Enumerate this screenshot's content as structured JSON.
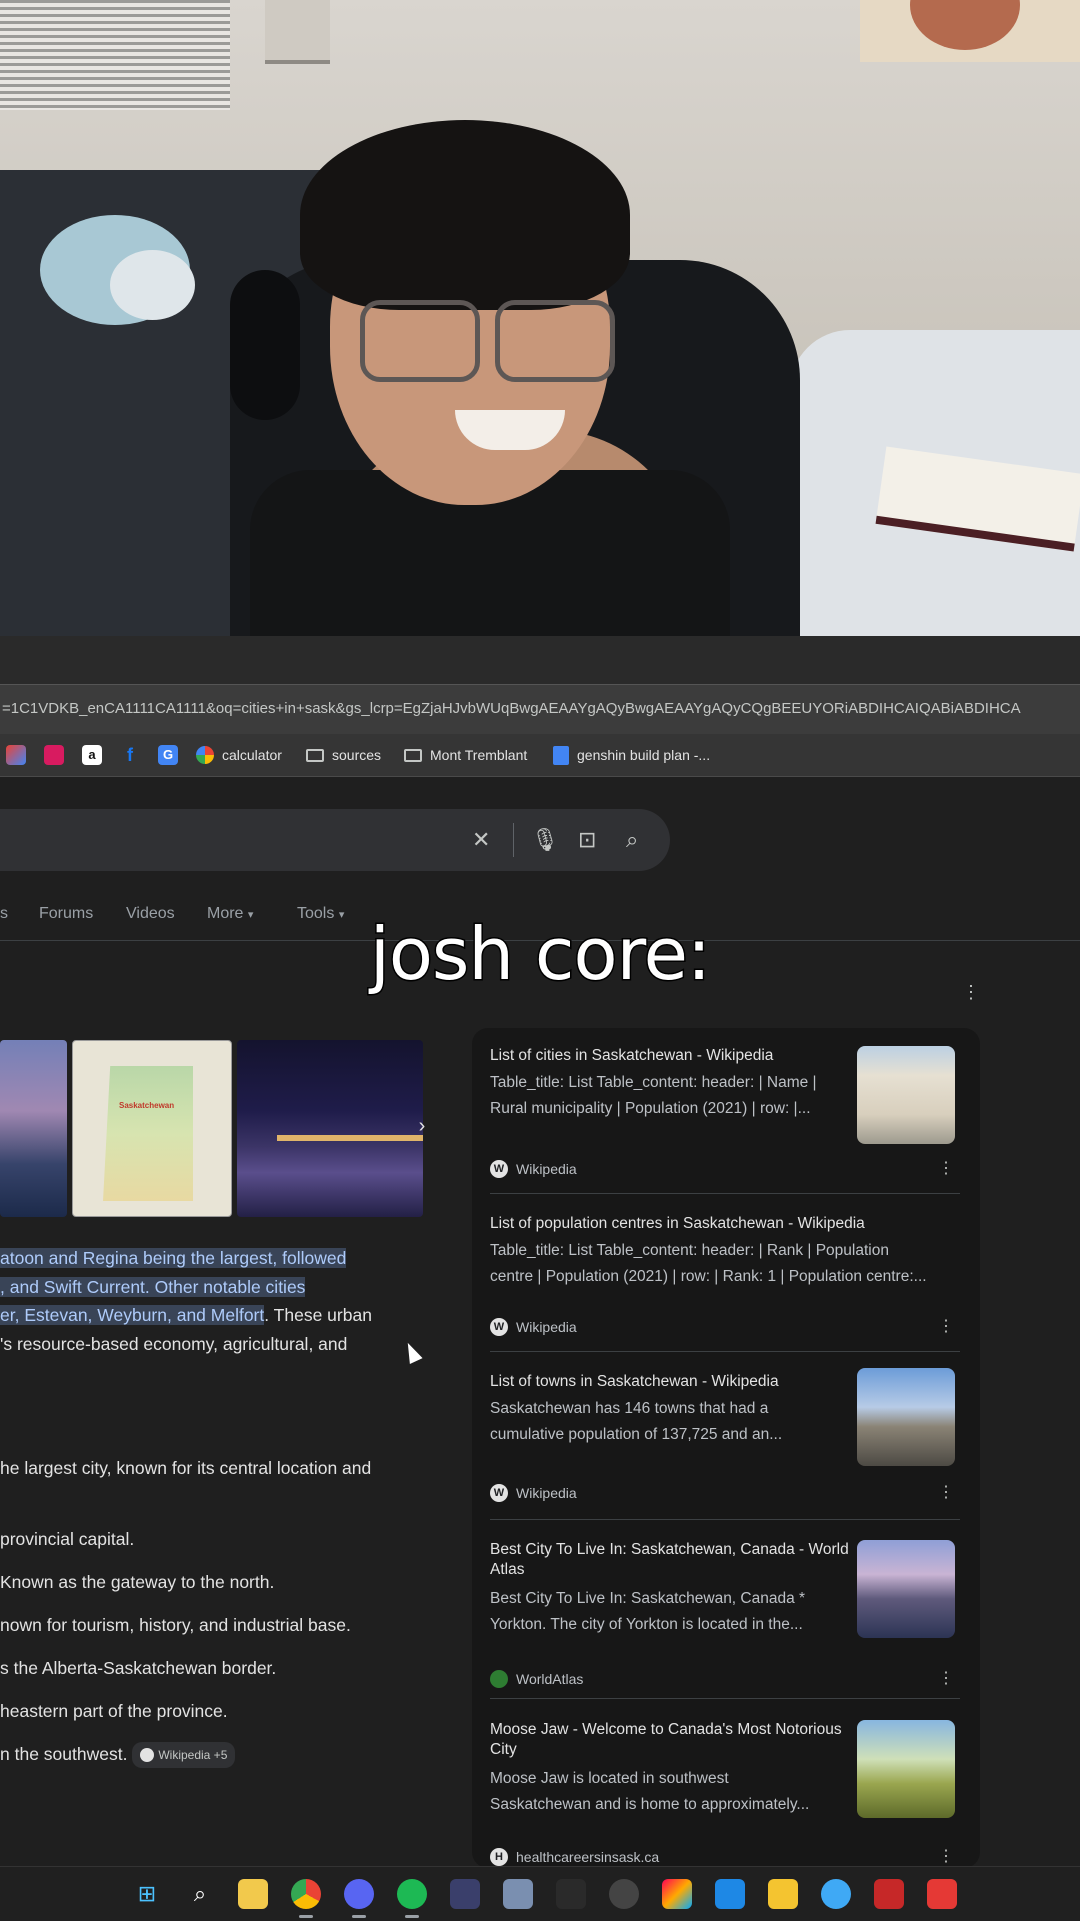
{
  "overlay_caption": "josh core:",
  "browser": {
    "url": "=1C1VDKB_enCA1111CA1111&oq=cities+in+sask&gs_lcrp=EgZjaHJvbWUqBwgAEAAYgAQyBwgAEAAYgAQyCQgBEEUYORiABDIHCAIQABiABDIHCA",
    "bookmarks": [
      {
        "label": "calculator",
        "icon": "google-icon"
      },
      {
        "label": "sources",
        "icon": "folder-icon"
      },
      {
        "label": "Mont Tremblant",
        "icon": "folder-icon"
      },
      {
        "label": "genshin build plan -...",
        "icon": "docs-icon"
      }
    ],
    "bookmark_icons": [
      "extension-icon",
      "app-icon",
      "amazon-icon",
      "facebook-icon",
      "translate-icon"
    ]
  },
  "search": {
    "icons": [
      "clear-icon",
      "mic-icon",
      "lens-icon",
      "search-icon"
    ],
    "tabs": [
      "Forums",
      "Videos",
      "More",
      "Tools"
    ]
  },
  "ai_overview": {
    "lines": [
      {
        "hl": "atoon and Regina being the largest, followed",
        "rest": ""
      },
      {
        "hl": ", and Swift Current. Other notable cities",
        "rest": ""
      },
      {
        "hl": "er, Estevan, Weyburn, and Melfort",
        "rest": ". These urban"
      },
      {
        "hl": "",
        "rest": "'s resource-based economy, agricultural, and"
      }
    ],
    "bullets": [
      "he largest city, known for its central location and",
      "provincial capital.",
      "Known as the gateway to the north.",
      "nown for tourism, history, and industrial base.",
      "s the Alberta-Saskatchewan border.",
      "heastern part of the province.",
      "n the southwest."
    ],
    "chip": "Wikipedia +5",
    "image_labels": {
      "map": "Saskatchewan"
    }
  },
  "results": [
    {
      "title": "List of cities in Saskatchewan - Wikipedia",
      "snippet1": "Table_title: List Table_content: header: | Name |",
      "snippet2": "Rural municipality | Population (2021) | row: |...",
      "source": "Wikipedia",
      "fav": "W",
      "image": "building"
    },
    {
      "title": "List of population centres in Saskatchewan - Wikipedia",
      "snippet1": "Table_title: List Table_content: header: | Rank | Population",
      "snippet2": "centre | Population (2021) | row: | Rank: 1 | Population centre:...",
      "source": "Wikipedia",
      "fav": "W",
      "image": ""
    },
    {
      "title": "List of towns in Saskatchewan - Wikipedia",
      "snippet1": "Saskatchewan has 146 towns that had a",
      "snippet2": "cumulative population of 137,725 and an...",
      "source": "Wikipedia",
      "fav": "W",
      "image": "street"
    },
    {
      "title": "Best City To Live In: Saskatchewan, Canada - World Atlas",
      "snippet1": "Best City To Live In: Saskatchewan, Canada *",
      "snippet2": "Yorkton. The city of Yorkton is located in the...",
      "source": "WorldAtlas",
      "fav": "",
      "image": "skyline"
    },
    {
      "title": "Moose Jaw - Welcome to Canada's Most Notorious City",
      "snippet1": "Moose Jaw is located in southwest",
      "snippet2": "Saskatchewan and is home to approximately...",
      "source": "healthcareersinsask.ca",
      "fav": "H",
      "image": "prairie"
    }
  ],
  "taskbar": [
    "windows-start-icon",
    "search-icon",
    "file-explorer-icon",
    "chrome-icon",
    "discord-icon",
    "spotify-icon",
    "app-icon",
    "app-icon",
    "app-icon",
    "app-icon",
    "app-icon",
    "app-icon",
    "app-icon",
    "app-icon",
    "app-icon",
    "app-icon"
  ]
}
